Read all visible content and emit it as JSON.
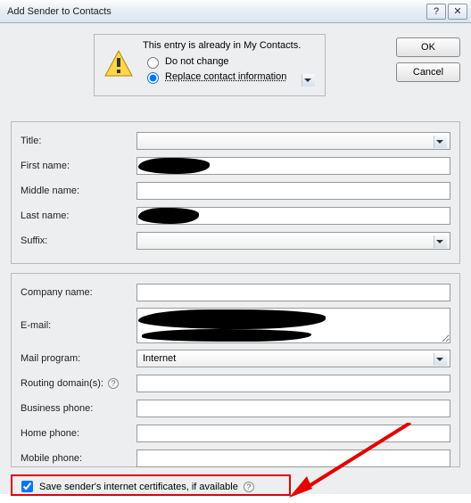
{
  "window": {
    "title": "Add Sender to Contacts"
  },
  "buttons": {
    "ok": "OK",
    "cancel": "Cancel",
    "help": "?",
    "close": "✕"
  },
  "notice": {
    "heading": "This entry is already in My Contacts.",
    "opt_keep": "Do not change",
    "opt_replace": "Replace contact information",
    "selected": "replace"
  },
  "labels": {
    "title": "Title:",
    "first_name": "First name:",
    "middle_name": "Middle name:",
    "last_name": "Last name:",
    "suffix": "Suffix:",
    "company": "Company name:",
    "email": "E-mail:",
    "mail_program": "Mail program:",
    "routing": "Routing domain(s):",
    "business_phone": "Business phone:",
    "home_phone": "Home phone:",
    "mobile_phone": "Mobile phone:"
  },
  "values": {
    "title": "",
    "first_name": "",
    "middle_name": "",
    "last_name": "",
    "suffix": "",
    "company": "",
    "email": "",
    "mail_program": "Internet",
    "routing": "",
    "business_phone": "",
    "home_phone": "",
    "mobile_phone": ""
  },
  "save_certs_label": "Save sender's internet certificates, if available",
  "save_certs_checked": true
}
